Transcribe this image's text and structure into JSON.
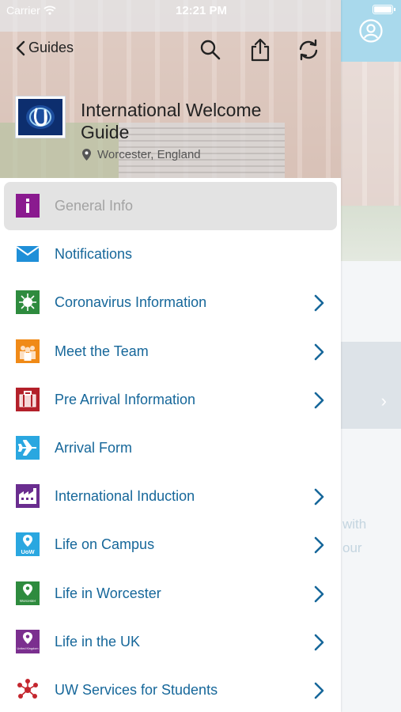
{
  "status_bar": {
    "carrier": "Carrier",
    "time": "12:21 PM"
  },
  "nav": {
    "back_label": "Guides"
  },
  "guide": {
    "title": "International Welcome Guide",
    "location": "Worcester, England"
  },
  "background": {
    "text_line_1": "with",
    "text_line_2": "our"
  },
  "colors": {
    "label": "#16679a",
    "active_bg": "#e3e3e3",
    "profile_bg": "#a9d9ec"
  },
  "menu": [
    {
      "label": "General Info",
      "icon": "info-icon",
      "color": "#8a1a8f",
      "has_chevron": false,
      "active": true
    },
    {
      "label": "Notifications",
      "icon": "envelope-icon",
      "color": "#1f8fd8",
      "has_chevron": false
    },
    {
      "label": "Coronavirus Information",
      "icon": "virus-icon",
      "color": "#2e8b3e",
      "has_chevron": true
    },
    {
      "label": "Meet the Team",
      "icon": "team-icon",
      "color": "#f08a17",
      "has_chevron": true
    },
    {
      "label": "Pre Arrival Information",
      "icon": "suitcase-icon",
      "color": "#b3202a",
      "has_chevron": true
    },
    {
      "label": "Arrival Form",
      "icon": "airplane-icon",
      "color": "#2aa7e0",
      "has_chevron": false
    },
    {
      "label": "International Induction",
      "icon": "factory-icon",
      "color": "#6a2d8f",
      "has_chevron": true
    },
    {
      "label": "Life on Campus",
      "icon": "uow-pin-icon",
      "color": "#2aa7e0",
      "has_chevron": true,
      "badge": "UoW"
    },
    {
      "label": "Life in Worcester",
      "icon": "worcester-pin-icon",
      "color": "#2e8b3e",
      "has_chevron": true,
      "badge": "Worcester"
    },
    {
      "label": "Life in the UK",
      "icon": "uk-pin-icon",
      "color": "#7b2f8f",
      "has_chevron": true,
      "badge": "United Kingdom"
    },
    {
      "label": "UW Services for Students",
      "icon": "network-icon",
      "color": "#c4262e",
      "has_chevron": true
    }
  ]
}
